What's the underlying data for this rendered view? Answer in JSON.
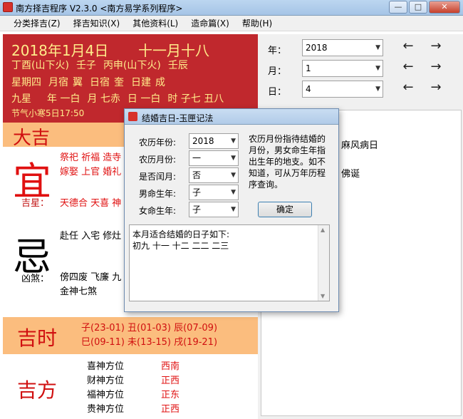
{
  "window": {
    "title": "南方择吉程序 V2.3.0    <南方易学系列程序>",
    "minimize": "—",
    "maximize": "□",
    "close": "✕"
  },
  "menu": [
    "分类择吉(Z)",
    "择吉知识(X)",
    "其他资料(L)",
    "造命篇(X)",
    "帮助(H)"
  ],
  "header": {
    "solar_date": "2018年1月4日",
    "lunar_date": "十一月十八",
    "line2": [
      "丁酉(山下火)",
      "壬子",
      "丙申(山下火)",
      "壬辰"
    ],
    "line3": [
      "星期四",
      "月宿",
      "翼",
      "日宿",
      "奎",
      "日建",
      "成"
    ],
    "line4": [
      "九星",
      "年 一白",
      "月 七赤",
      "日 一白",
      "时 子七 丑八"
    ],
    "solar_term": "节气小寒5日17:50"
  },
  "daji": {
    "label": "大吉"
  },
  "yi": {
    "label": "宜",
    "items_line1": "祭祀 祈福 造寺",
    "items_line2": "嫁娶 上官 婚礼",
    "jixing_label": "吉星：",
    "jixing_value": "天德合 天喜 神"
  },
  "ji": {
    "label": "忌",
    "items": "赴任 入宅 修灶",
    "xiongsha_label": "凶煞：",
    "xiongsha_line1": "傍四废 飞廉 九",
    "xiongsha_line2": "金神七煞"
  },
  "jishi": {
    "label": "吉时",
    "line1": "子(23-01) 丑(01-03) 辰(07-09)",
    "line2": "巳(09-11) 未(13-15) 戌(19-21)"
  },
  "jifang": {
    "label": "吉方",
    "rows": [
      {
        "name": "喜神方位",
        "dir": "西南"
      },
      {
        "name": "财神方位",
        "dir": "正西"
      },
      {
        "name": "福神方位",
        "dir": "正东"
      },
      {
        "name": "贵神方位",
        "dir": "正西"
      }
    ]
  },
  "right": {
    "year_label": "年：",
    "year_value": "2018",
    "month_label": "月：",
    "month_value": "1",
    "day_label": "日：",
    "day_value": "4",
    "prev": "←",
    "next": "→",
    "text1": "麻风病日",
    "text2": "佛诞"
  },
  "dialog": {
    "title": "结婚吉日-玉匣记法",
    "lunar_year_label": "农历年份:",
    "lunar_year_value": "2018",
    "lunar_month_label": "农历月份:",
    "lunar_month_value": "一",
    "leap_label": "是否闰月:",
    "leap_value": "否",
    "male_label": "男命生年:",
    "male_value": "子",
    "female_label": "女命生年:",
    "female_value": "子",
    "note": "农历月份指待结婚的月份，男女命生年指出生年的地支。如不知道，可从万年历程序查询。",
    "ok_label": "确定",
    "result_line1": "本月适合结婚的日子如下:",
    "result_line2": "初九 十一 十二 二二 二三"
  },
  "colors": {
    "header_red": "#c0282d",
    "band_orange": "#fbbd7e",
    "accent_red": "#e01010",
    "header_yellow": "#ffec8a"
  }
}
